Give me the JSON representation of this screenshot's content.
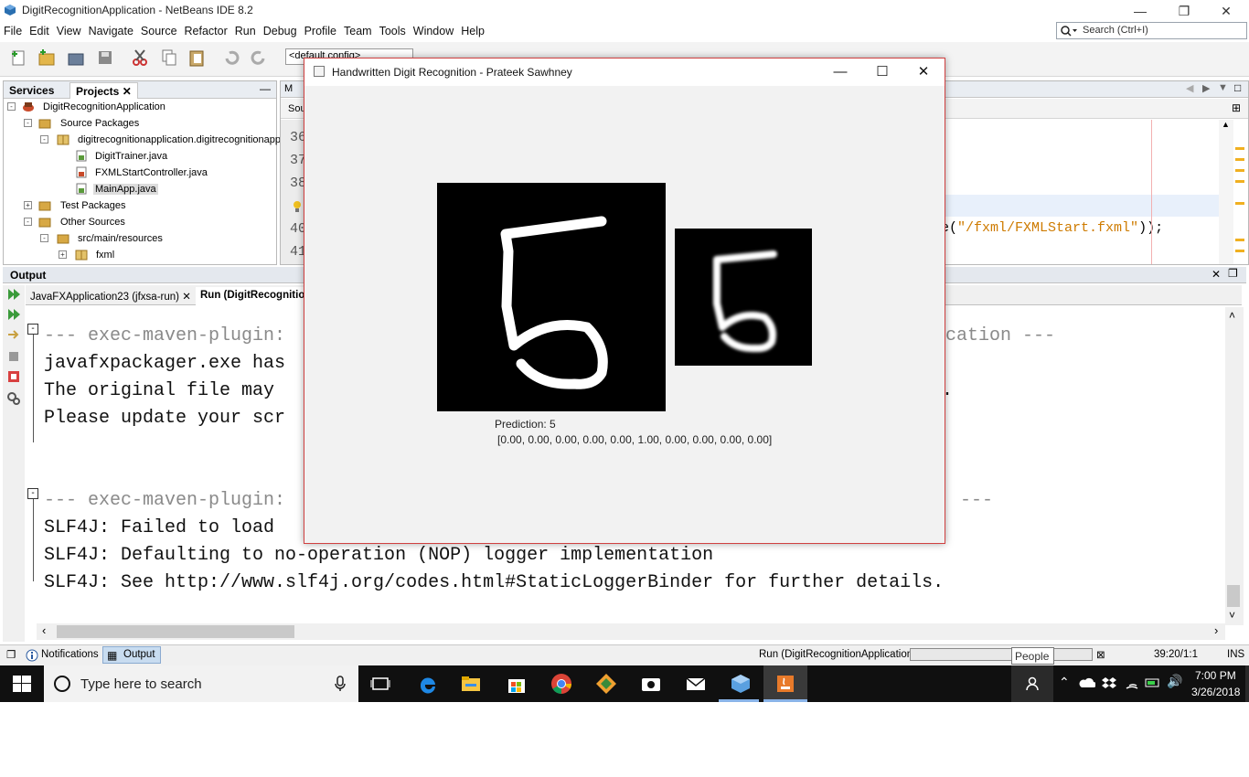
{
  "window": {
    "title": "DigitRecognitionApplication - NetBeans IDE 8.2"
  },
  "menu": [
    "File",
    "Edit",
    "View",
    "Navigate",
    "Source",
    "Refactor",
    "Run",
    "Debug",
    "Profile",
    "Team",
    "Tools",
    "Window",
    "Help"
  ],
  "search": {
    "placeholder": "Search (Ctrl+I)"
  },
  "toolbar": {
    "config": "<default config>"
  },
  "panel_tabs": {
    "services": "Services",
    "projects": "Projects"
  },
  "tree": [
    {
      "label": "DigitRecognitionApplication"
    },
    {
      "label": "Source Packages"
    },
    {
      "label": "digitrecognitionapplication.digitrecognitionapp"
    },
    {
      "label": "DigitTrainer.java"
    },
    {
      "label": "FXMLStartController.java"
    },
    {
      "label": "MainApp.java"
    },
    {
      "label": "Test Packages"
    },
    {
      "label": "Other Sources"
    },
    {
      "label": "src/main/resources"
    },
    {
      "label": "fxml"
    }
  ],
  "editor": {
    "tab_label": "M",
    "source_tab": "Sou",
    "line_numbers": [
      "36",
      "37",
      "38",
      "40",
      "41"
    ],
    "code_fragment_1": "e(",
    "code_fragment_2": "\"/fxml/FXMLStart.fxml\"",
    "code_fragment_3": "));"
  },
  "output": {
    "title": "Output",
    "tabs": [
      "JavaFXApplication23 (jfxsa-run)",
      "Run (DigitRecognitio"
    ],
    "lines": [
      {
        "left": "--- exec-maven-plugin:",
        "right": "lication ---"
      },
      {
        "left": "javafxpackager.exe has",
        "right": ""
      },
      {
        "left": "The original file may",
        "right": "."
      },
      {
        "left": "Please update your scr",
        "right": ""
      },
      {
        "left": "",
        "right": ""
      },
      {
        "left": "--- exec-maven-plugin:",
        "right": "---"
      },
      {
        "left": "SLF4J: Failed to load",
        "right": ""
      },
      {
        "left": "SLF4J: Defaulting to no-operation (NOP) logger implementation",
        "right": ""
      },
      {
        "left": "SLF4J: See http://www.slf4j.org/codes.html#StaticLoggerBinder for further details.",
        "right": ""
      }
    ]
  },
  "status": {
    "notifications": "Notifications",
    "output": "Output",
    "task": "Run (DigitRecognitionApplication)",
    "position": "39:20/1:1",
    "mode": "INS",
    "tooltip": "People"
  },
  "taskbar": {
    "search_placeholder": "Type here to search",
    "time": "7:00 PM",
    "date": "3/26/2018"
  },
  "dialog": {
    "title": "Handwritten Digit Recognition - Prateek Sawhney",
    "digit": "5",
    "prediction": "Prediction: 5",
    "probabilities": "[0.00, 0.00, 0.00, 0.00, 0.00, 1.00, 0.00, 0.00, 0.00, 0.00]"
  }
}
